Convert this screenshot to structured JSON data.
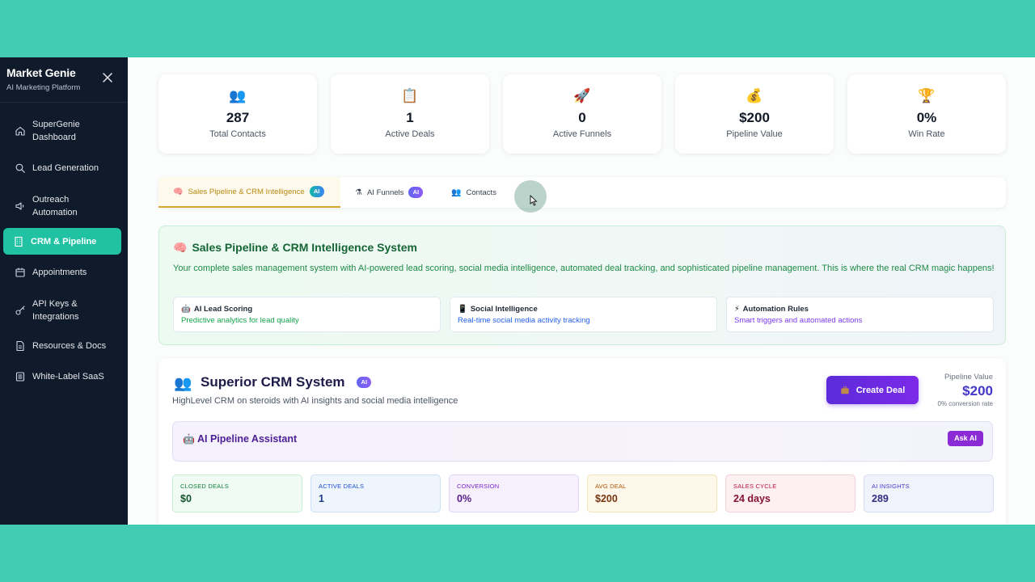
{
  "app": {
    "title": "Market Genie",
    "subtitle": "AI Marketing Platform"
  },
  "sidebar": {
    "items": [
      {
        "label": "SuperGenie Dashboard",
        "icon": "home-icon"
      },
      {
        "label": "Lead Generation",
        "icon": "search-icon"
      },
      {
        "label": "Outreach Automation",
        "icon": "megaphone-icon"
      },
      {
        "label": "CRM & Pipeline",
        "icon": "building-icon",
        "active": true
      },
      {
        "label": "Appointments",
        "icon": "calendar-icon"
      },
      {
        "label": "API Keys & Integrations",
        "icon": "key-icon"
      },
      {
        "label": "Resources & Docs",
        "icon": "document-icon"
      },
      {
        "label": "White-Label SaaS",
        "icon": "layers-icon"
      }
    ]
  },
  "stats": [
    {
      "emoji": "👥",
      "value": "287",
      "label": "Total Contacts"
    },
    {
      "emoji": "📋",
      "value": "1",
      "label": "Active Deals"
    },
    {
      "emoji": "🚀",
      "value": "0",
      "label": "Active Funnels"
    },
    {
      "emoji": "💰",
      "value": "$200",
      "label": "Pipeline Value"
    },
    {
      "emoji": "🏆",
      "value": "0%",
      "label": "Win Rate"
    }
  ],
  "tabs": [
    {
      "emoji": "🧠",
      "label": "Sales Pipeline & CRM Intelligence",
      "badge": "AI",
      "active": true
    },
    {
      "emoji": "⚗",
      "label": "AI Funnels",
      "badge": "AI"
    },
    {
      "emoji": "👥",
      "label": "Contacts"
    }
  ],
  "intel": {
    "emoji": "🧠",
    "title": "Sales Pipeline & CRM Intelligence System",
    "description": "Your complete sales management system with AI-powered lead scoring, social media intelligence, automated deal tracking, and sophisticated pipeline management. This is where the real CRM magic happens!",
    "features": [
      {
        "emoji": "🤖",
        "title": "AI Lead Scoring",
        "desc": "Predictive analytics for lead quality"
      },
      {
        "emoji": "📱",
        "title": "Social Intelligence",
        "desc": "Real-time social media activity tracking"
      },
      {
        "emoji": "⚡",
        "title": "Automation Rules",
        "desc": "Smart triggers and automated actions"
      }
    ]
  },
  "crm": {
    "emoji": "👥",
    "title": "Superior CRM System",
    "badge": "AI",
    "subtitle": "HighLevel CRM on steroids with AI insights and social media intelligence",
    "create_label": "Create Deal",
    "pipeline_label": "Pipeline Value",
    "pipeline_value": "$200",
    "conversion_rate": "0% conversion rate",
    "assistant": {
      "emoji": "🤖",
      "title": "AI Pipeline Assistant",
      "ask_label": "Ask AI"
    },
    "metrics": [
      {
        "label": "CLOSED DEALS",
        "value": "$0"
      },
      {
        "label": "ACTIVE DEALS",
        "value": "1"
      },
      {
        "label": "CONVERSION",
        "value": "0%"
      },
      {
        "label": "AVG DEAL",
        "value": "$200"
      },
      {
        "label": "SALES CYCLE",
        "value": "24 days"
      },
      {
        "label": "AI INSIGHTS",
        "value": "289"
      }
    ]
  },
  "colors": {
    "sidebar_bg": "#0f1b2b",
    "accent_teal": "#21c1a3",
    "outer_bg": "#43cbb6",
    "create_button": "#5b2bd9",
    "ask_button": "#8b2bd6"
  }
}
